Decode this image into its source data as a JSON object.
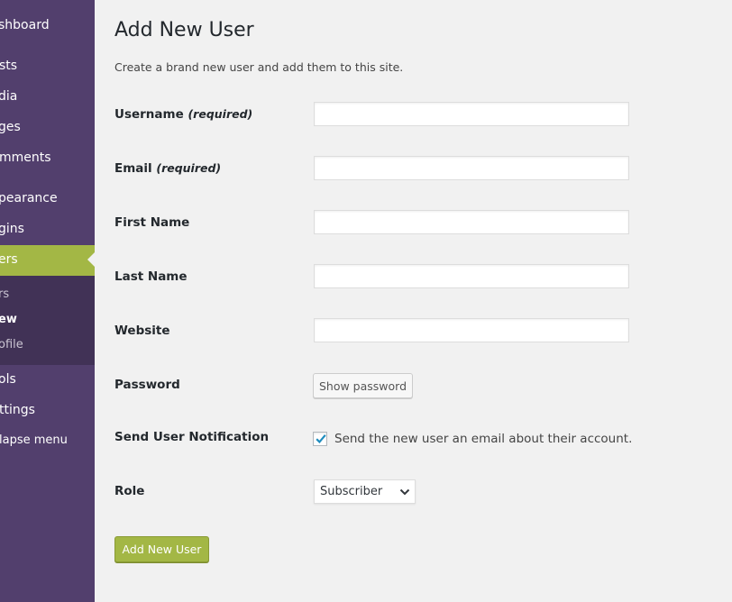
{
  "sidebar": {
    "items": [
      {
        "label": "shboard"
      },
      {
        "label": "sts"
      },
      {
        "label": "dia"
      },
      {
        "label": "ges"
      },
      {
        "label": "mments"
      },
      {
        "label": "pearance"
      },
      {
        "label": "gins"
      },
      {
        "label": "ers"
      },
      {
        "label": "ols"
      },
      {
        "label": "ttings"
      },
      {
        "label": "lapse menu"
      }
    ],
    "submenu": [
      {
        "label": "rs"
      },
      {
        "label": "ew"
      },
      {
        "label": "ofile"
      }
    ],
    "colors": {
      "background": "#523f6d",
      "submenu": "#413256",
      "active": "#a3b745"
    }
  },
  "main": {
    "title": "Add New User",
    "description": "Create a brand new user and add them to this site.",
    "fields": {
      "username": {
        "label": "Username",
        "required_note": "(required)",
        "value": ""
      },
      "email": {
        "label": "Email",
        "required_note": "(required)",
        "value": ""
      },
      "first_name": {
        "label": "First Name",
        "value": ""
      },
      "last_name": {
        "label": "Last Name",
        "value": ""
      },
      "website": {
        "label": "Website",
        "value": ""
      }
    },
    "password": {
      "label": "Password",
      "button_label": "Show password"
    },
    "notification": {
      "label": "Send User Notification",
      "checkbox_label": "Send the new user an email about their account.",
      "checked": true
    },
    "role": {
      "label": "Role",
      "selected": "Subscriber"
    },
    "submit_label": "Add New User"
  }
}
